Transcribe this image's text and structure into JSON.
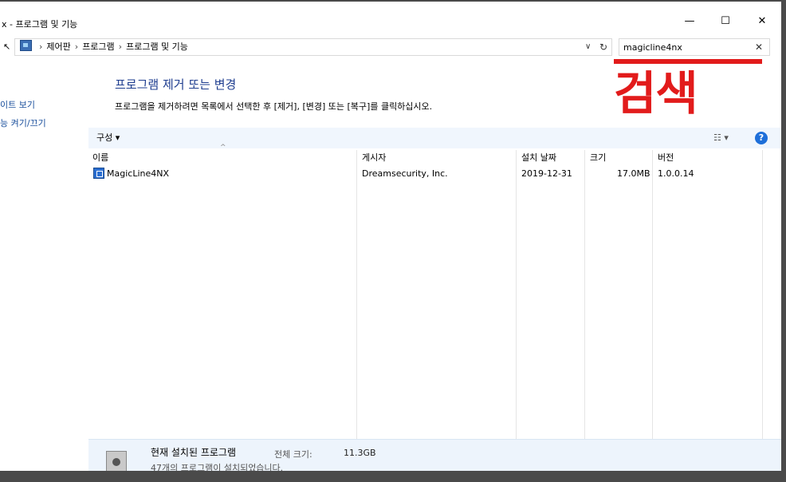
{
  "window": {
    "title": "x - 프로그램 및 기능",
    "minimize": "—",
    "maximize": "☐",
    "close": "✕"
  },
  "address": {
    "back_glyph": "↖",
    "breadcrumb": [
      "제어판",
      "프로그램",
      "프로그램 및 기능"
    ],
    "separator": "›",
    "dropdown_glyph": "∨",
    "refresh_glyph": "↻"
  },
  "search": {
    "value": "magicline4nx",
    "clear_glyph": "✕"
  },
  "annotation": {
    "text": "검색",
    "color": "#e21b1b"
  },
  "left_panel": {
    "items": [
      "이트 보기",
      "능 켜기/끄기"
    ]
  },
  "main": {
    "heading": "프로그램 제거 또는 변경",
    "description": "프로그램을 제거하려면 목록에서 선택한 후 [제거], [변경] 또는 [복구]를 클릭하십시오."
  },
  "toolbar": {
    "organize": "구성 ▾",
    "view_glyph": "☷ ▾",
    "help": "?"
  },
  "table": {
    "columns": [
      "이름",
      "게시자",
      "설치 날짜",
      "크기",
      "버전"
    ],
    "sort_glyph": "^",
    "rows": [
      {
        "name": "MagicLine4NX",
        "publisher": "Dreamsecurity, Inc.",
        "date": "2019-12-31",
        "size": "17.0MB",
        "version": "1.0.0.14"
      }
    ]
  },
  "status": {
    "title": "현재 설치된 프로그램",
    "size_label": "전체 크기:",
    "size_value": "11.3GB",
    "count": "47개의 프로그램이 설치되었습니다."
  }
}
